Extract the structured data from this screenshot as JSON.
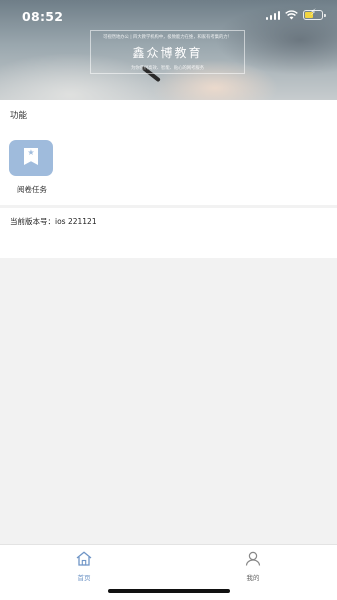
{
  "status_bar": {
    "time": "08:52"
  },
  "banner": {
    "top_text": "可视然地办公 | 四大教学机构中，极致能力在维，和家有考集的力！",
    "brand": "鑫众博教育",
    "bottom_text": "为你提供高效、智能、贴心的网考服务"
  },
  "functions": {
    "section_title": "功能",
    "items": [
      {
        "label": "阅卷任务",
        "icon": "bookmark-star-icon"
      }
    ]
  },
  "version": {
    "text": "当前版本号：ios 221121"
  },
  "tabbar": {
    "home_label": "首页",
    "mine_label": "我的"
  },
  "colors": {
    "accent": "#6f95c6",
    "tile": "#9fbbdc",
    "battery": "#f2d542"
  }
}
